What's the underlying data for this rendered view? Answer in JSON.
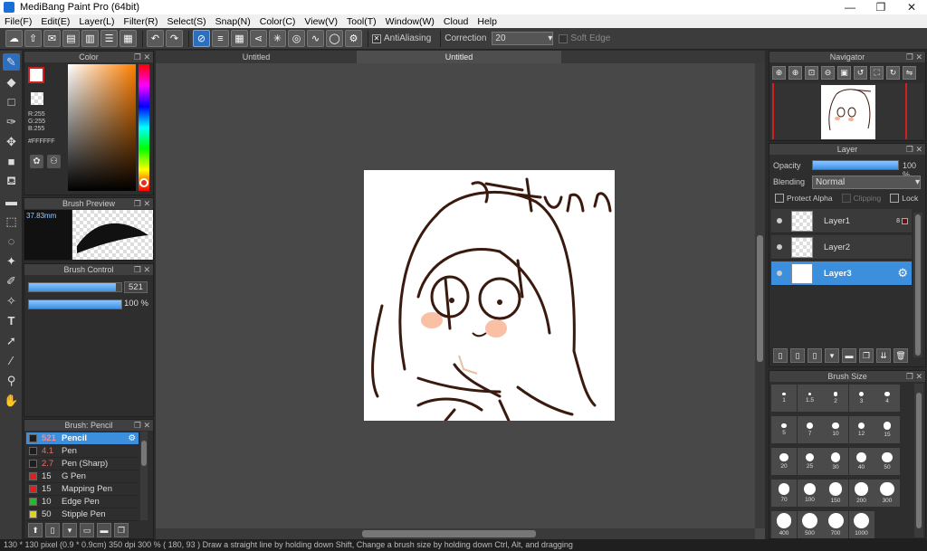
{
  "window": {
    "title": "MediBang Paint Pro (64bit)",
    "min": "—",
    "max": "❐",
    "close": "✕"
  },
  "menu": [
    "File(F)",
    "Edit(E)",
    "Layer(L)",
    "Filter(R)",
    "Select(S)",
    "Snap(N)",
    "Color(C)",
    "View(V)",
    "Tool(T)",
    "Window(W)",
    "Cloud",
    "Help"
  ],
  "toolbar": {
    "antialiasing_label": "AntiAliasing",
    "antialiasing_checked": true,
    "correction_label": "Correction",
    "correction_value": "20",
    "softedge_label": "Soft Edge"
  },
  "color_panel": {
    "title": "Color",
    "r": "R:255",
    "g": "G:255",
    "b": "B:255",
    "hex": "#FFFFFF"
  },
  "brush_preview": {
    "title": "Brush Preview",
    "size": "37.83mm"
  },
  "brush_control": {
    "title": "Brush Control",
    "size_value": "521",
    "opacity_value": "100 %",
    "size_fraction": 0.94,
    "opacity_fraction": 1.0
  },
  "brush_list": {
    "title": "Brush: Pencil",
    "items": [
      {
        "num": "521",
        "name": "Pencil",
        "color": "#1e1e1e",
        "selected": true
      },
      {
        "num": "4.1",
        "name": "Pen",
        "color": "#1e1e1e",
        "selected": false
      },
      {
        "num": "2.7",
        "name": "Pen (Sharp)",
        "color": "#1e1e1e",
        "selected": false
      },
      {
        "num": "15",
        "name": "G Pen",
        "color": "#e02020",
        "selected": false
      },
      {
        "num": "15",
        "name": "Mapping Pen",
        "color": "#e02020",
        "selected": false
      },
      {
        "num": "10",
        "name": "Edge Pen",
        "color": "#20c020",
        "selected": false
      },
      {
        "num": "50",
        "name": "Stipple Pen",
        "color": "#e0d020",
        "selected": false
      }
    ]
  },
  "tabs": [
    "Untitled",
    "Untitled"
  ],
  "navigator": {
    "title": "Navigator"
  },
  "layer_panel": {
    "title": "Layer",
    "opacity_label": "Opacity",
    "opacity_value": "100 %",
    "opacity_fraction": 1.0,
    "blending_label": "Blending",
    "blending_value": "Normal",
    "protect_alpha": "Protect Alpha",
    "clipping": "Clipping",
    "lock": "Lock",
    "layers": [
      {
        "name": "Layer1",
        "selected": false,
        "badge": "8"
      },
      {
        "name": "Layer2",
        "selected": false,
        "badge": ""
      },
      {
        "name": "Layer3",
        "selected": true,
        "badge": ""
      }
    ]
  },
  "brush_size": {
    "title": "Brush Size",
    "sizes": [
      "1",
      "1.5",
      "2",
      "3",
      "4",
      "5",
      "7",
      "10",
      "12",
      "15",
      "20",
      "25",
      "30",
      "40",
      "50",
      "70",
      "100",
      "150",
      "200",
      "300",
      "400",
      "500",
      "700",
      "1000"
    ]
  },
  "status": {
    "text": "130 * 130 pixel   (0.9 * 0.9cm)   350 dpi   300 %   ( 180, 93 )   Draw a straight line by holding down Shift, Change a brush size by holding down Ctrl, Alt, and dragging"
  },
  "colors": {
    "accent": "#2d6ebd",
    "selected_brush": "#3c8fdc"
  }
}
